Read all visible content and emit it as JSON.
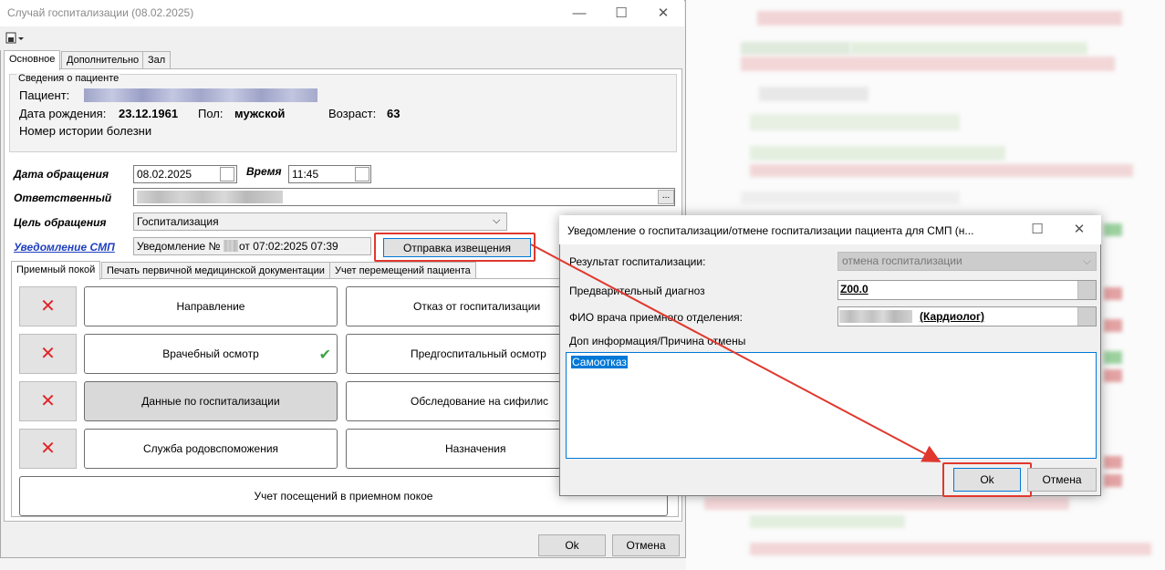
{
  "main_window": {
    "title": "Случай госпитализации (08.02.2025)",
    "minimize": "—",
    "maximize": "☐",
    "close": "✕",
    "toolbar_icon": "document-dropdown-icon",
    "tabs": [
      {
        "label": "Основное"
      },
      {
        "label": "Дополнительно"
      },
      {
        "label": "Зал"
      }
    ]
  },
  "patient_info": {
    "legend": "Сведения о пациенте",
    "patient_label": "Пациент:",
    "birth_label": "Дата рождения:",
    "birth_value": "23.12.1961",
    "sex_label": "Пол:",
    "sex_value": "мужской",
    "age_label": "Возраст:",
    "age_value": "63",
    "history_label": "Номер истории болезни"
  },
  "form": {
    "date_label": "Дата обращения",
    "date_value": "08.02.2025",
    "time_label": "Время",
    "time_value": "11:45",
    "responsible_label": "Ответственный",
    "purpose_label": "Цель обращения",
    "purpose_value": "Госпитализация",
    "smp_link": "Уведомление СМП",
    "notice_prefix": "Уведомление № 1",
    "notice_suffix": "от 07:02:2025 07:39",
    "send_button": "Отправка извещения",
    "dots": "..."
  },
  "sub_tabs": [
    {
      "label": "Приемный покой"
    },
    {
      "label": "Печать первичной медицинской документации"
    },
    {
      "label": "Учет перемещений пациента"
    }
  ],
  "grid_buttons": {
    "left_col": [
      "Направление",
      "Врачебный осмотр",
      "Данные по госпитализации",
      "Служба родовспоможения"
    ],
    "right_col": [
      "Отказ от госпитализации",
      "Предгоспитальный осмотр",
      "Обследование на сифилис",
      "Назначения"
    ],
    "visits": "Учет посещений в приемном покое"
  },
  "main_footer": {
    "ok": "Ok",
    "cancel": "Отмена"
  },
  "dialog": {
    "title": "Уведомление о госпитализации/отмене госпитализации пациента для СМП (н...",
    "maximize": "☐",
    "close": "✕",
    "result_label": "Результат госпитализации:",
    "result_value": "отмена госпитализации",
    "diagnosis_label": "Предварительный диагноз",
    "diagnosis_value": "Z00.0",
    "doctor_label": "ФИО врача приемного отделения:",
    "doctor_role": "(Кардиолог)",
    "extra_label": "Доп информация/Причина отмены",
    "extra_value": "Самоотказ",
    "ok": "Ok",
    "cancel": "Отмена"
  },
  "colors": {
    "accent_red": "#e0382e",
    "link_blue": "#1f3fbf",
    "selection_blue": "#0078d7",
    "check_green": "#3ea34a"
  }
}
